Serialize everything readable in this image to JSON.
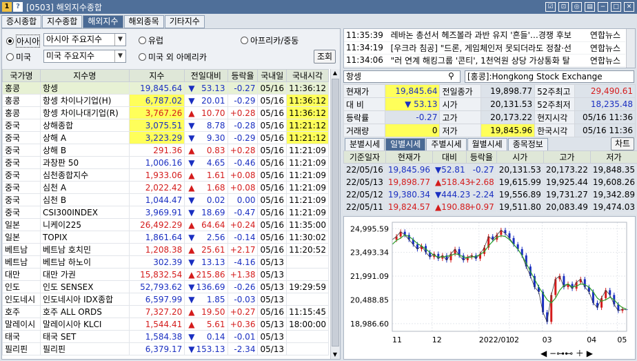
{
  "window": {
    "title": "[0503] 해외지수종합"
  },
  "tabs": [
    "증시종합",
    "지수종합",
    "해외지수",
    "해외종목",
    "기타지수"
  ],
  "controls": {
    "asia_radio": "아시아",
    "asia_select": "아시아 주요지수",
    "us_radio": "미국",
    "us_select": "미국 주요지수",
    "europe_radio": "유럽",
    "americas_radio": "미국 외 아메리카",
    "africa_radio": "아프리카/중동",
    "search_button": "조회"
  },
  "list": {
    "headers": [
      "국가명",
      "지수명",
      "지수",
      "전일대비",
      "등락율",
      "국내일",
      "국내시각"
    ],
    "rows": [
      {
        "country": "홍콩",
        "name": "항셍",
        "index": "19,845.64",
        "dir": "down",
        "change": "53.13",
        "rate": "-0.27",
        "date": "05/16",
        "time": "11:36:12",
        "hl": false
      },
      {
        "country": "홍콩",
        "name": "항셍 차이나기업(H)",
        "index": "6,787.02",
        "dir": "down",
        "change": "20.01",
        "rate": "-0.29",
        "date": "05/16",
        "time": "11:36:12",
        "hl": true
      },
      {
        "country": "홍콩",
        "name": "항셍 차이나대기업(R)",
        "index": "3,767.26",
        "dir": "up",
        "change": "10.70",
        "rate": "+0.28",
        "date": "05/16",
        "time": "11:36:12",
        "hl": true
      },
      {
        "country": "중국",
        "name": "상해종합",
        "index": "3,075.51",
        "dir": "down",
        "change": "8.78",
        "rate": "-0.28",
        "date": "05/16",
        "time": "11:21:12",
        "hl": true
      },
      {
        "country": "중국",
        "name": "상해 A",
        "index": "3,223.29",
        "dir": "down",
        "change": "9.30",
        "rate": "-0.29",
        "date": "05/16",
        "time": "11:21:12",
        "hl": true
      },
      {
        "country": "중국",
        "name": "상해 B",
        "index": "291.36",
        "dir": "up",
        "change": "0.83",
        "rate": "+0.28",
        "date": "05/16",
        "time": "11:21:09",
        "hl": false
      },
      {
        "country": "중국",
        "name": "과창판 50",
        "index": "1,006.16",
        "dir": "down",
        "change": "4.65",
        "rate": "-0.46",
        "date": "05/16",
        "time": "11:21:09",
        "hl": false
      },
      {
        "country": "중국",
        "name": "심천종합지수",
        "index": "1,933.06",
        "dir": "up",
        "change": "1.61",
        "rate": "+0.08",
        "date": "05/16",
        "time": "11:21:09",
        "hl": false
      },
      {
        "country": "중국",
        "name": "심천 A",
        "index": "2,022.42",
        "dir": "up",
        "change": "1.68",
        "rate": "+0.08",
        "date": "05/16",
        "time": "11:21:09",
        "hl": false
      },
      {
        "country": "중국",
        "name": "심천 B",
        "index": "1,044.47",
        "dir": "down",
        "change": "0.02",
        "rate": "0.00",
        "date": "05/16",
        "time": "11:21:09",
        "hl": false
      },
      {
        "country": "중국",
        "name": "CSI300INDEX",
        "index": "3,969.91",
        "dir": "down",
        "change": "18.69",
        "rate": "-0.47",
        "date": "05/16",
        "time": "11:21:09",
        "hl": false
      },
      {
        "country": "일본",
        "name": "니케이225",
        "index": "26,492.29",
        "dir": "up",
        "change": "64.64",
        "rate": "+0.24",
        "date": "05/16",
        "time": "11:35:00",
        "hl": false
      },
      {
        "country": "일본",
        "name": "TOPIX",
        "index": "1,861.64",
        "dir": "down",
        "change": "2.56",
        "rate": "-0.14",
        "date": "05/16",
        "time": "11:30:02",
        "hl": false
      },
      {
        "country": "베트남",
        "name": "베트남 호치민",
        "index": "1,208.38",
        "dir": "up",
        "change": "25.61",
        "rate": "+2.17",
        "date": "05/16",
        "time": "11:20:52",
        "hl": false
      },
      {
        "country": "베트남",
        "name": "베트남 하노이",
        "index": "302.39",
        "dir": "down",
        "change": "13.13",
        "rate": "-4.16",
        "date": "05/13",
        "time": "",
        "hl": false
      },
      {
        "country": "대만",
        "name": "대만 가권",
        "index": "15,832.54",
        "dir": "up",
        "change": "215.86",
        "rate": "+1.38",
        "date": "05/13",
        "time": "",
        "hl": false
      },
      {
        "country": "인도",
        "name": "인도 SENSEX",
        "index": "52,793.62",
        "dir": "down",
        "change": "136.69",
        "rate": "-0.26",
        "date": "05/13",
        "time": "19:29:59",
        "hl": false
      },
      {
        "country": "인도네시",
        "name": "인도네시아 IDX종합",
        "index": "6,597.99",
        "dir": "down",
        "change": "1.85",
        "rate": "-0.03",
        "date": "05/13",
        "time": "",
        "hl": false
      },
      {
        "country": "호주",
        "name": "호주 ALL ORDS",
        "index": "7,327.20",
        "dir": "up",
        "change": "19.50",
        "rate": "+0.27",
        "date": "05/16",
        "time": "11:15:45",
        "hl": false
      },
      {
        "country": "말레이시",
        "name": "말레이시아 KLCI",
        "index": "1,544.41",
        "dir": "up",
        "change": "5.61",
        "rate": "+0.36",
        "date": "05/13",
        "time": "18:00:00",
        "hl": false
      },
      {
        "country": "태국",
        "name": "태국 SET",
        "index": "1,584.38",
        "dir": "down",
        "change": "0.14",
        "rate": "-0.01",
        "date": "05/13",
        "time": "",
        "hl": false
      },
      {
        "country": "필리핀",
        "name": "필리핀",
        "index": "6,379.17",
        "dir": "down",
        "change": "153.13",
        "rate": "-2.34",
        "date": "05/13",
        "time": "",
        "hl": false
      }
    ]
  },
  "news": [
    {
      "time": "11:35:39",
      "text": "레바논 총선서 헤즈볼라 과반 유지 '흔들'…경쟁 후보",
      "src": "연합뉴스"
    },
    {
      "time": "11:34:19",
      "text": "[우크라 침공] \"드론, 게임체인저 못되더라도 정찰·선",
      "src": "연합뉴스"
    },
    {
      "time": "11:34:06",
      "text": "\"러 연계 해킹그룹 '콘티', 1천억원 상당 가상통화 탈",
      "src": "연합뉴스"
    }
  ],
  "detail": {
    "search_value": "항셍",
    "market": "[홍콩]:Hongkong Stock Exchange",
    "quote": [
      [
        {
          "l": "현재가"
        },
        {
          "v": "19,845.64",
          "cls": "dn yel"
        },
        {
          "l": "전일종가"
        },
        {
          "v": "19,898.77"
        },
        {
          "l": "52주최고"
        },
        {
          "v": "29,490.61",
          "cls": "up"
        }
      ],
      [
        {
          "l": "대  비"
        },
        {
          "v": "▼      53.13",
          "cls": "dn yel"
        },
        {
          "l": "시가"
        },
        {
          "v": "20,131.53"
        },
        {
          "l": "52주최저"
        },
        {
          "v": "18,235.48",
          "cls": "dn"
        }
      ],
      [
        {
          "l": "등락률"
        },
        {
          "v": "-0.27",
          "cls": "dn"
        },
        {
          "l": "고가"
        },
        {
          "v": "20,173.22"
        },
        {
          "l": "현지시각"
        },
        {
          "v": "05/16 11:36"
        }
      ],
      [
        {
          "l": "거래량"
        },
        {
          "v": "0",
          "cls": "yel"
        },
        {
          "l": "저가"
        },
        {
          "v": "19,845.96",
          "cls": "yel"
        },
        {
          "l": "한국시각"
        },
        {
          "v": "05/16 11:36"
        }
      ]
    ],
    "tabs": [
      "분별시세",
      "일별시세",
      "주별시세",
      "월별시세",
      "종목정보"
    ],
    "chart_button": "차트",
    "daily_headers": [
      "기준일자",
      "현재가",
      "대비",
      "등락율",
      "시가",
      "고가",
      "저가"
    ],
    "daily": [
      {
        "date": "22/05/16",
        "price": "19,845.96",
        "dir": "down",
        "chg": "52.81",
        "rate": "-0.27",
        "open": "20,131.53",
        "high": "20,173.22",
        "low": "19,848.35"
      },
      {
        "date": "22/05/13",
        "price": "19,898.77",
        "dir": "up",
        "chg": "518.43",
        "rate": "+2.68",
        "open": "19,615.99",
        "high": "19,925.44",
        "low": "19,608.26"
      },
      {
        "date": "22/05/12",
        "price": "19,380.34",
        "dir": "down",
        "chg": "444.23",
        "rate": "-2.24",
        "open": "19,556.89",
        "high": "19,731.27",
        "low": "19,342.89"
      },
      {
        "date": "22/05/11",
        "price": "19,824.57",
        "dir": "up",
        "chg": "190.88",
        "rate": "+0.97",
        "open": "19,511.80",
        "high": "20,083.49",
        "low": "19,474.03"
      }
    ]
  },
  "chart_data": {
    "type": "line",
    "y_ticks": [
      "24,995.59",
      "23,493.34",
      "21,991.09",
      "20,488.85",
      "18,986.60"
    ],
    "x_ticks": [
      "11",
      "12",
      "2022/01",
      "02",
      "03",
      "04",
      "05"
    ],
    "ylim": [
      18500,
      25400
    ],
    "series": [
      {
        "values": [
          24300,
          24500,
          24800,
          24600,
          24300,
          24000,
          23700,
          23900,
          23500,
          23200,
          23400,
          23100,
          23300,
          23000,
          23400,
          23700,
          23300,
          23000,
          23200,
          23300,
          23100,
          23400,
          23800,
          24500,
          24300,
          24600,
          24900,
          24700,
          24400,
          24000,
          23700,
          23300,
          22600,
          22000,
          21300,
          21000,
          19700,
          19100,
          20800,
          21800,
          22000,
          21300,
          21500,
          21200,
          21600,
          21800,
          21300,
          21000,
          20300,
          20000,
          20600,
          21100,
          20800,
          20200,
          19800,
          19900,
          19850
        ]
      },
      {
        "values": [
          24000,
          24250,
          24400,
          24600,
          24500,
          24300,
          24050,
          23900,
          23700,
          23500,
          23300,
          23200,
          23200,
          23250,
          23300,
          23400,
          23350,
          23200,
          23150,
          23200,
          23250,
          23350,
          23550,
          23900,
          24200,
          24450,
          24550,
          24500,
          24300,
          24000,
          23700,
          23300,
          22800,
          22300,
          21800,
          21300,
          20900,
          20500,
          20300,
          20600,
          21100,
          21400,
          21500,
          21300,
          21350,
          21500,
          21450,
          21300,
          21000,
          20600,
          20400,
          20500,
          20650,
          20500,
          20200,
          20000,
          19900
        ]
      }
    ]
  }
}
